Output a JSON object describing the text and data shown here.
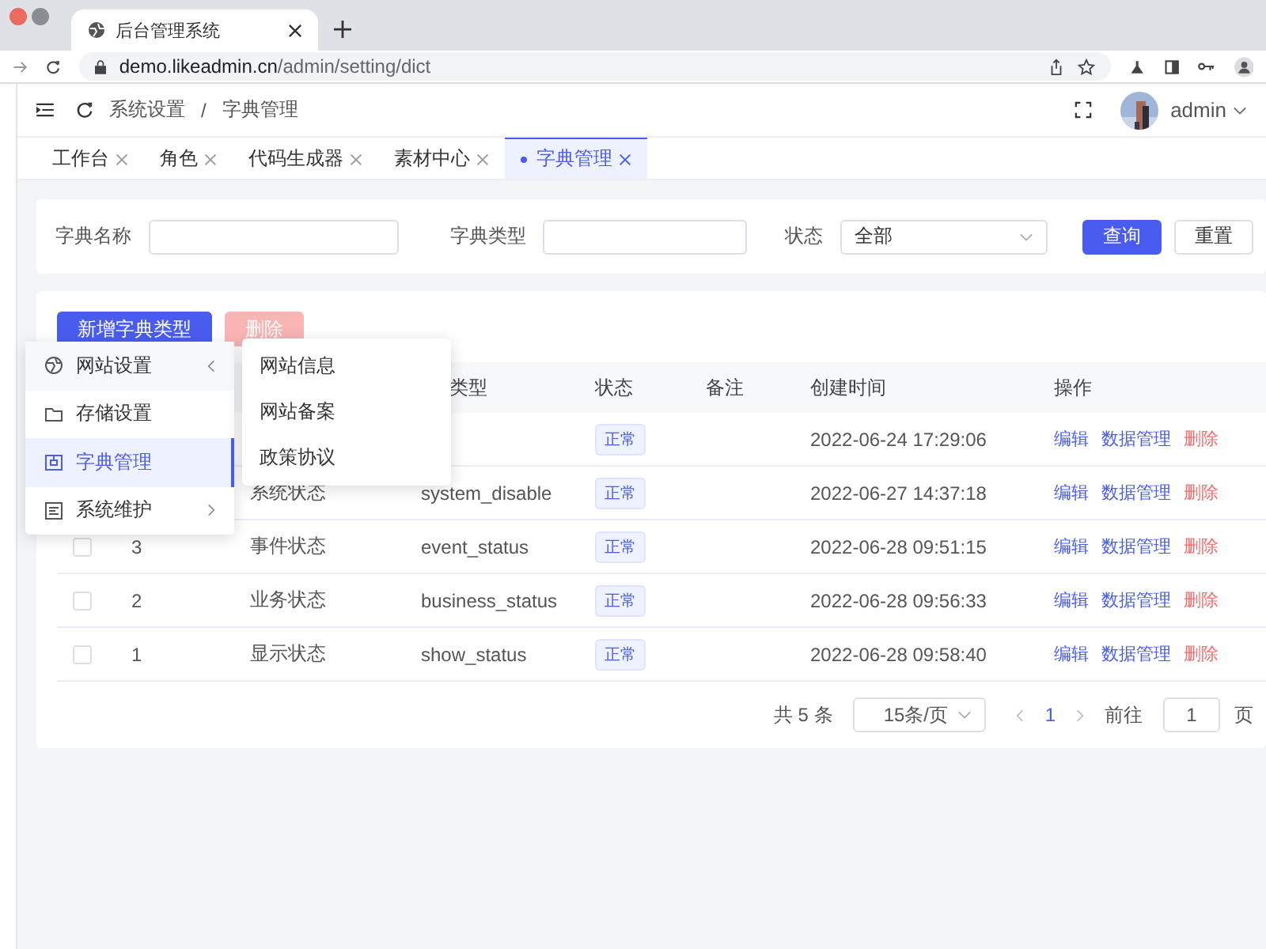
{
  "browser": {
    "tab_title": "后台管理系统",
    "url_domain": "demo.likeadmin.cn",
    "url_path": "/admin/setting/dict"
  },
  "header": {
    "breadcrumb": [
      "系统设置",
      "字典管理"
    ],
    "separator": "/",
    "user": "admin"
  },
  "tabs": [
    {
      "label": "工作台",
      "selected": false
    },
    {
      "label": "角色",
      "selected": false
    },
    {
      "label": "代码生成器",
      "selected": false
    },
    {
      "label": "素材中心",
      "selected": false
    },
    {
      "label": "字典管理",
      "selected": true
    }
  ],
  "search": {
    "fields": [
      {
        "label": "字典名称",
        "kind": "input"
      },
      {
        "label": "字典类型",
        "kind": "input"
      },
      {
        "label": "状态",
        "kind": "select",
        "value": "全部"
      }
    ],
    "buttons": [
      {
        "label": "查询",
        "kind": "primary"
      },
      {
        "label": "重置",
        "kind": "default"
      }
    ]
  },
  "toolbar": [
    {
      "label": "新增字典类型",
      "kind": "primary",
      "disabled": false
    },
    {
      "label": "删除",
      "kind": "danger",
      "disabled": true
    }
  ],
  "table": {
    "columns": [
      "类型",
      "状态",
      "备注",
      "创建时间",
      "操作"
    ],
    "rows": [
      {
        "status": "正常",
        "created": "2022-06-24 17:29:06",
        "actions": [
          {
            "label": "编辑",
            "kind": "link"
          },
          {
            "label": "数据管理",
            "kind": "link"
          },
          {
            "label": "删除",
            "kind": "danger"
          }
        ]
      },
      {
        "name": "系统状态",
        "type": "system_disable",
        "status": "正常",
        "created": "2022-06-27 14:37:18",
        "actions": [
          {
            "label": "编辑",
            "kind": "link"
          },
          {
            "label": "数据管理",
            "kind": "link"
          },
          {
            "label": "删除",
            "kind": "danger"
          }
        ]
      },
      {
        "checked": false,
        "id": "3",
        "name": "事件状态",
        "type": "event_status",
        "status": "正常",
        "created": "2022-06-28 09:51:15",
        "actions": [
          {
            "label": "编辑",
            "kind": "link"
          },
          {
            "label": "数据管理",
            "kind": "link"
          },
          {
            "label": "删除",
            "kind": "danger"
          }
        ]
      },
      {
        "checked": false,
        "id": "2",
        "name": "业务状态",
        "type": "business_status",
        "status": "正常",
        "created": "2022-06-28 09:56:33",
        "actions": [
          {
            "label": "编辑",
            "kind": "link"
          },
          {
            "label": "数据管理",
            "kind": "link"
          },
          {
            "label": "删除",
            "kind": "danger"
          }
        ]
      },
      {
        "checked": false,
        "id": "1",
        "name": "显示状态",
        "type": "show_status",
        "status": "正常",
        "created": "2022-06-28 09:58:40",
        "actions": [
          {
            "label": "编辑",
            "kind": "link"
          },
          {
            "label": "数据管理",
            "kind": "link"
          },
          {
            "label": "删除",
            "kind": "danger"
          }
        ]
      }
    ]
  },
  "pagination": {
    "total": "共 5 条",
    "page_size": "15条/页",
    "current": "1",
    "goto_label": "前往",
    "goto_value": "1",
    "page_suffix": "页"
  },
  "menu": {
    "items": [
      {
        "label": "网站设置",
        "kind": "globe",
        "selected": false,
        "expanded": true
      },
      {
        "label": "存储设置",
        "kind": "folder",
        "selected": false
      },
      {
        "label": "字典管理",
        "kind": "box",
        "selected": true
      },
      {
        "label": "系统维护",
        "kind": "screen",
        "selected": false,
        "expanded": false
      }
    ],
    "submenu": [
      {
        "label": "网站信息"
      },
      {
        "label": "网站备案"
      },
      {
        "label": "政策协议"
      }
    ]
  }
}
